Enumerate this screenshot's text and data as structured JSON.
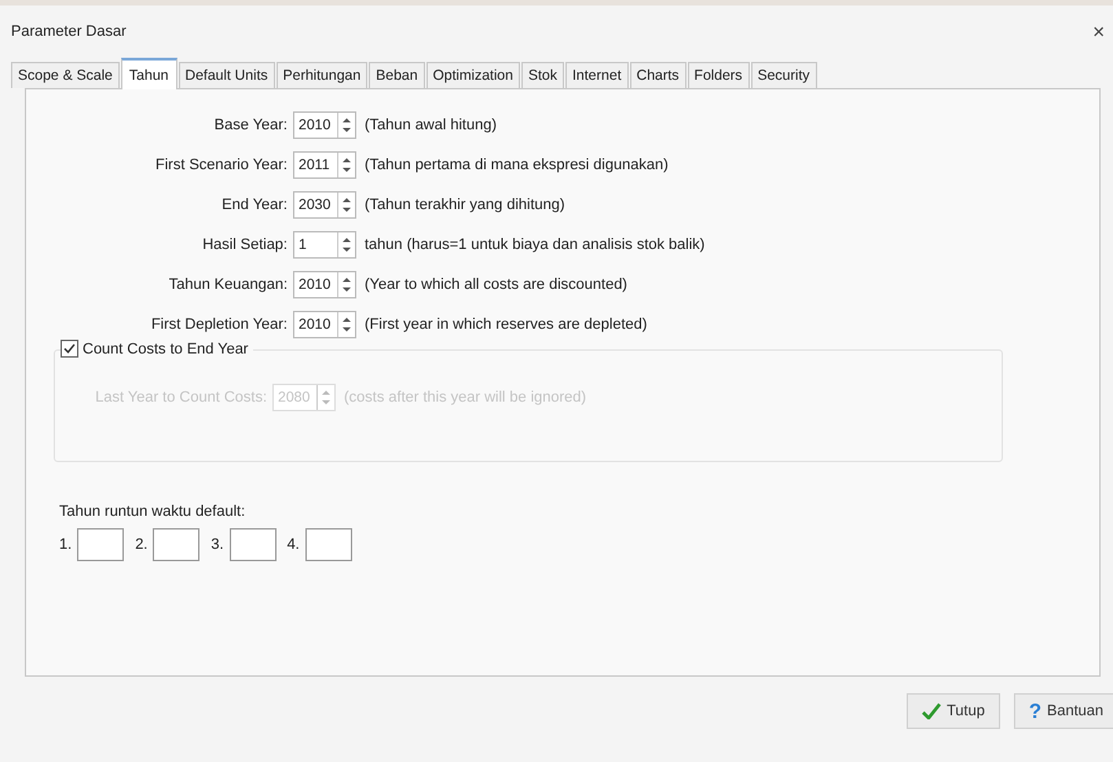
{
  "window": {
    "title": "Parameter Dasar",
    "close": "×"
  },
  "tabs": [
    {
      "label": "Scope & Scale",
      "selected": false
    },
    {
      "label": "Tahun",
      "selected": true
    },
    {
      "label": "Default Units",
      "selected": false
    },
    {
      "label": "Perhitungan",
      "selected": false
    },
    {
      "label": "Beban",
      "selected": false
    },
    {
      "label": "Optimization",
      "selected": false
    },
    {
      "label": "Stok",
      "selected": false
    },
    {
      "label": "Internet",
      "selected": false
    },
    {
      "label": "Charts",
      "selected": false
    },
    {
      "label": "Folders",
      "selected": false
    },
    {
      "label": "Security",
      "selected": false
    }
  ],
  "rows": [
    {
      "label": "Base Year:",
      "value": "2010",
      "note": "(Tahun awal hitung)"
    },
    {
      "label": "First Scenario Year:",
      "value": "2011",
      "note": "(Tahun pertama di mana ekspresi digunakan)"
    },
    {
      "label": "End Year:",
      "value": "2030",
      "note": "(Tahun terakhir yang dihitung)"
    },
    {
      "label": "Hasil Setiap:",
      "value": "1",
      "note": "tahun (harus=1 untuk biaya dan analisis stok balik)"
    },
    {
      "label": "Tahun Keuangan:",
      "value": "2010",
      "note": "(Year to which all costs are  discounted)"
    },
    {
      "label": "First Depletion Year:",
      "value": "2010",
      "note": "(First year in which reserves are depleted)"
    }
  ],
  "count_costs": {
    "label": "Count Costs to End Year",
    "checked": true,
    "row": {
      "label": "Last Year to Count Costs:",
      "value": "2080",
      "note": "(costs after this year will be ignored)",
      "disabled": true
    }
  },
  "defaults": {
    "title": "Tahun runtun waktu default:",
    "fields": [
      {
        "label": "1."
      },
      {
        "label": "2."
      },
      {
        "label": "3."
      },
      {
        "label": "4."
      }
    ]
  },
  "buttons": [
    {
      "kind": "ok",
      "label": "Tutup"
    },
    {
      "kind": "help",
      "label": "Bantuan",
      "icon": "?"
    }
  ]
}
